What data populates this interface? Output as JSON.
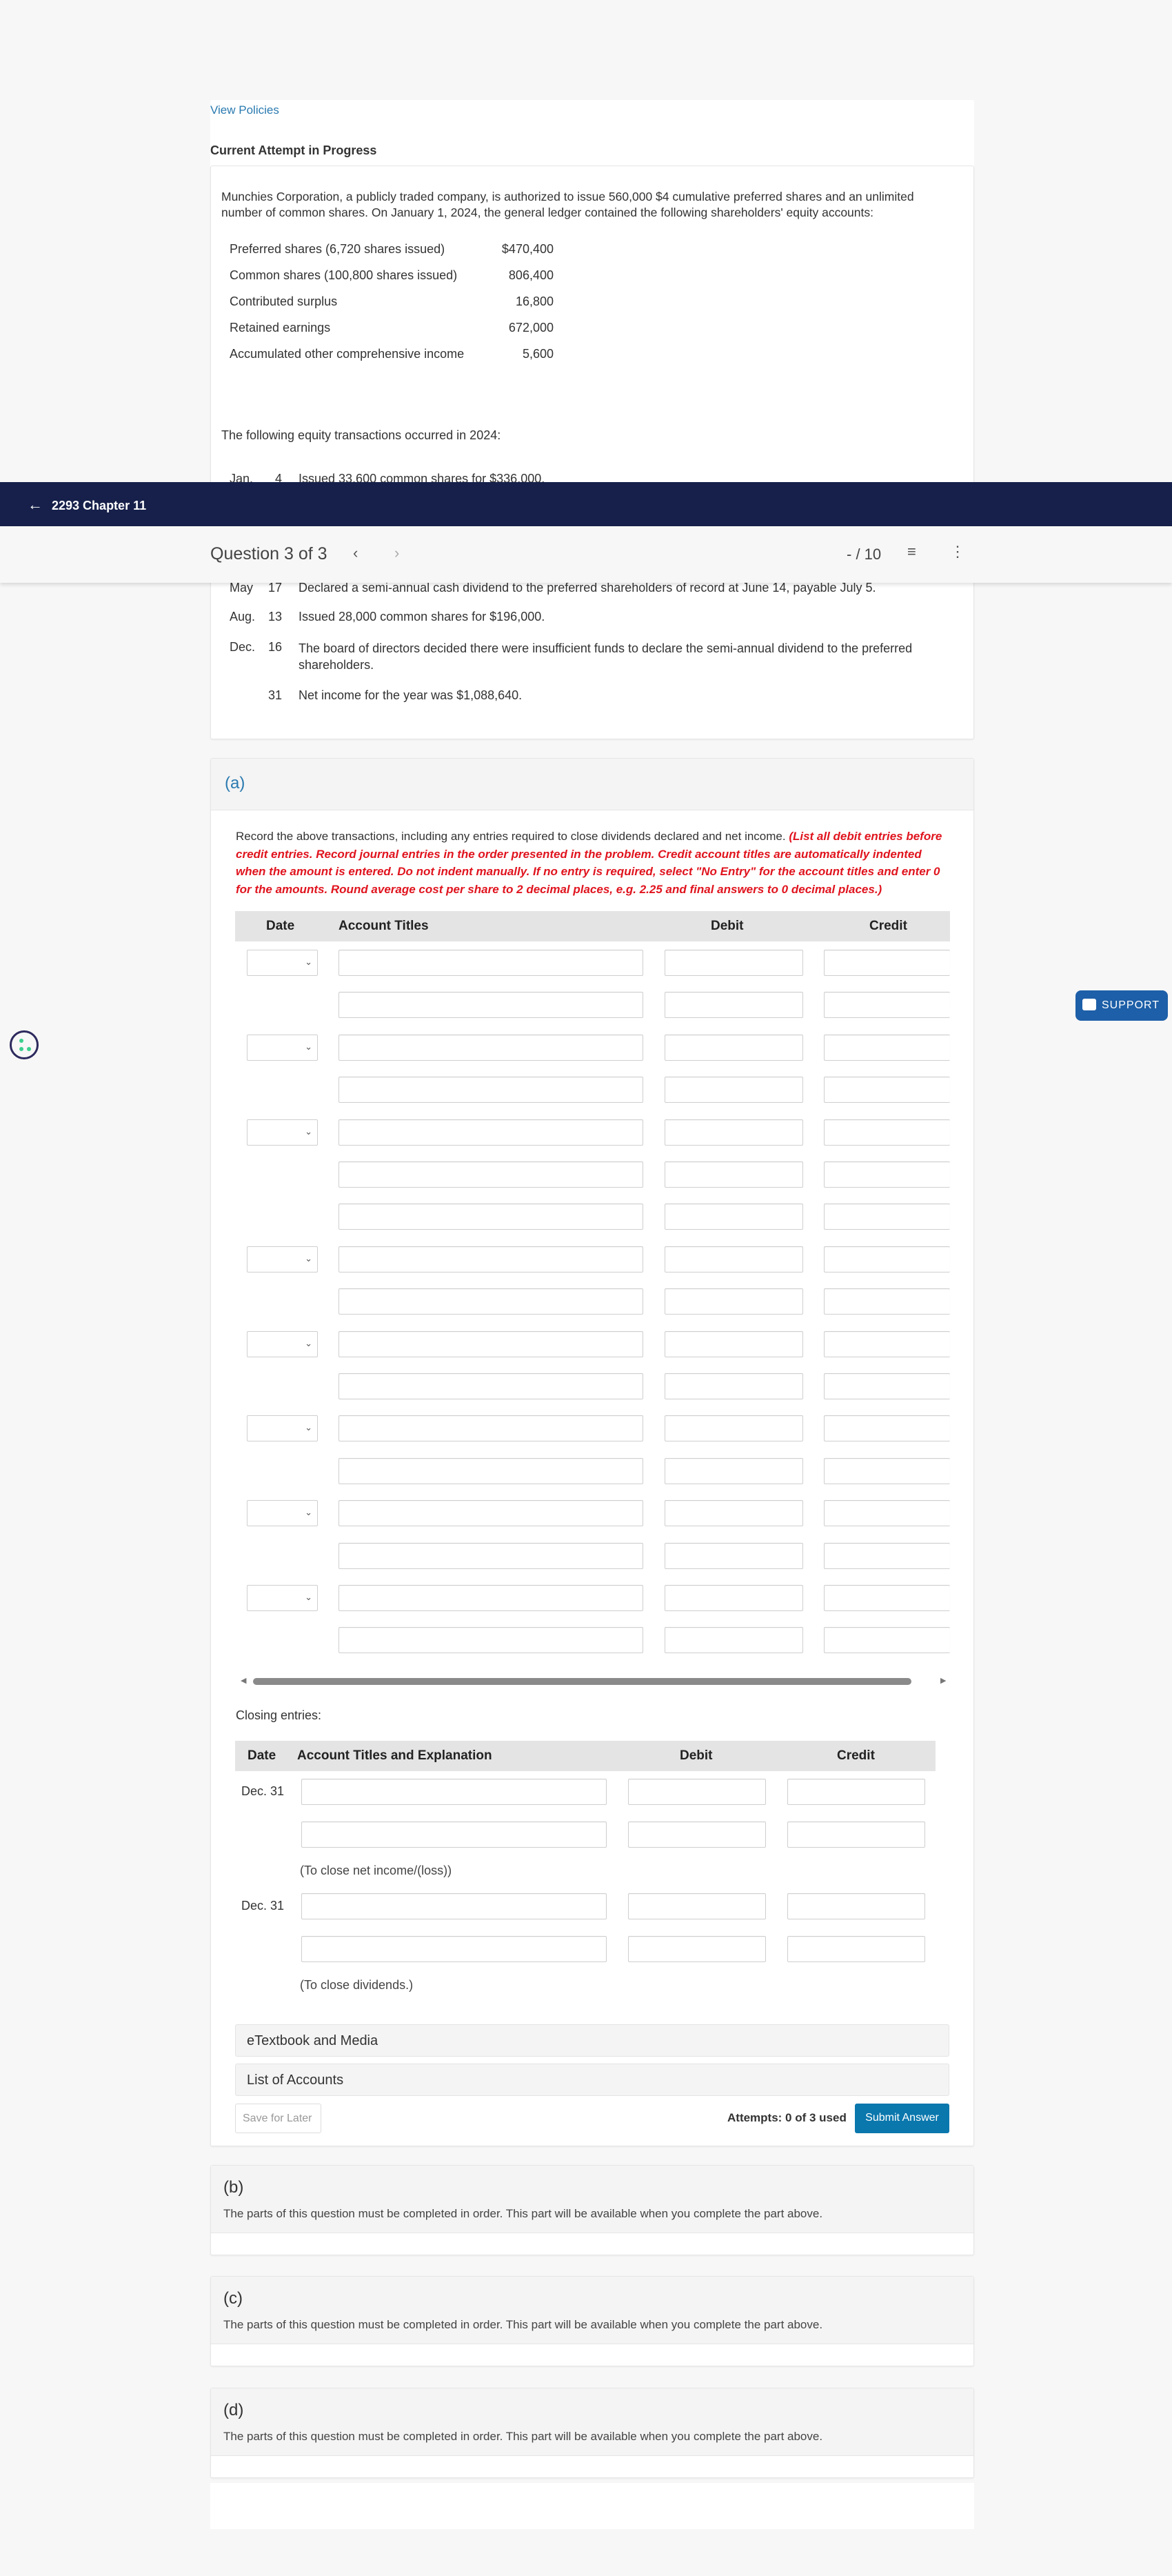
{
  "policies_link": "View Policies",
  "attempt_status": "Current Attempt in Progress",
  "problem": {
    "intro": "Munchies Corporation, a publicly traded company, is authorized to issue 560,000 $4 cumulative preferred shares and an unlimited number of common shares. On January 1, 2024, the general ledger contained the following shareholders' equity accounts:",
    "accounts": [
      {
        "name": "Preferred shares (6,720 shares issued)",
        "amount": "$470,400"
      },
      {
        "name": "Common shares (100,800 shares issued)",
        "amount": "806,400"
      },
      {
        "name": "Contributed surplus",
        "amount": "16,800"
      },
      {
        "name": "Retained earnings",
        "amount": "672,000"
      },
      {
        "name": "Accumulated other comprehensive income",
        "amount": "5,600"
      }
    ],
    "transactions_intro": "The following equity transactions occurred in 2024:",
    "transactions": [
      {
        "month": "Jan.",
        "day": "4",
        "text": "Issued 33,600 common shares for $336,000."
      },
      {
        "month": "May",
        "day": "17",
        "text": "Declared a semi-annual cash dividend to the preferred shareholders of record at June 14, payable July 5."
      },
      {
        "month": "Aug.",
        "day": "13",
        "text": "Issued 28,000 common shares for $196,000."
      },
      {
        "month": "Dec.",
        "day": "16",
        "text": "The board of directors decided there were insufficient funds to declare the semi-annual dividend to the preferred shareholders."
      },
      {
        "month": "",
        "day": "31",
        "text": "Net income for the year was $1,088,640."
      }
    ]
  },
  "header": {
    "back_label": "2293 Chapter 11",
    "question_label": "Question 3 of 3",
    "score": "- / 10"
  },
  "part_a": {
    "label": "(a)",
    "instruction": "Record the above transactions, including any entries required to close dividends declared and net income. ",
    "instruction_red": "(List all debit entries before credit entries. Record journal entries in the order presented in the problem. Credit account titles are automatically indented when the amount is entered. Do not indent manually. If no entry is required, select \"No Entry\" for the account titles and enter 0 for the amounts. Round average cost per share to 2 decimal places, e.g. 2.25 and final answers to 0 decimal places.)",
    "columns": {
      "date": "Date",
      "account": "Account Titles",
      "debit": "Debit",
      "credit": "Credit"
    },
    "closing_label": "Closing entries:",
    "closing_columns": {
      "date": "Date",
      "account": "Account Titles and Explanation",
      "debit": "Debit",
      "credit": "Credit"
    },
    "closing_entries": [
      {
        "date": "Dec. 31",
        "explanation": "(To close net income/(loss))"
      },
      {
        "date": "Dec. 31",
        "explanation": "(To close dividends.)"
      }
    ],
    "etextbook": "eTextbook and Media",
    "list_accounts": "List of Accounts",
    "save_later": "Save for Later",
    "attempts": "Attempts: 0 of 3 used",
    "submit": "Submit Answer"
  },
  "locked_parts": [
    {
      "label": "(b)",
      "text": "The parts of this question must be completed in order. This part will be available when you complete the part above."
    },
    {
      "label": "(c)",
      "text": "The parts of this question must be completed in order. This part will be available when you complete the part above."
    },
    {
      "label": "(d)",
      "text": "The parts of this question must be completed in order. This part will be available when you complete the part above."
    }
  ],
  "support_label": "SUPPORT",
  "colors": {
    "navy": "#16204a",
    "accent": "#0a77ad",
    "required": "#e0141e",
    "support": "#1d5fa8"
  }
}
